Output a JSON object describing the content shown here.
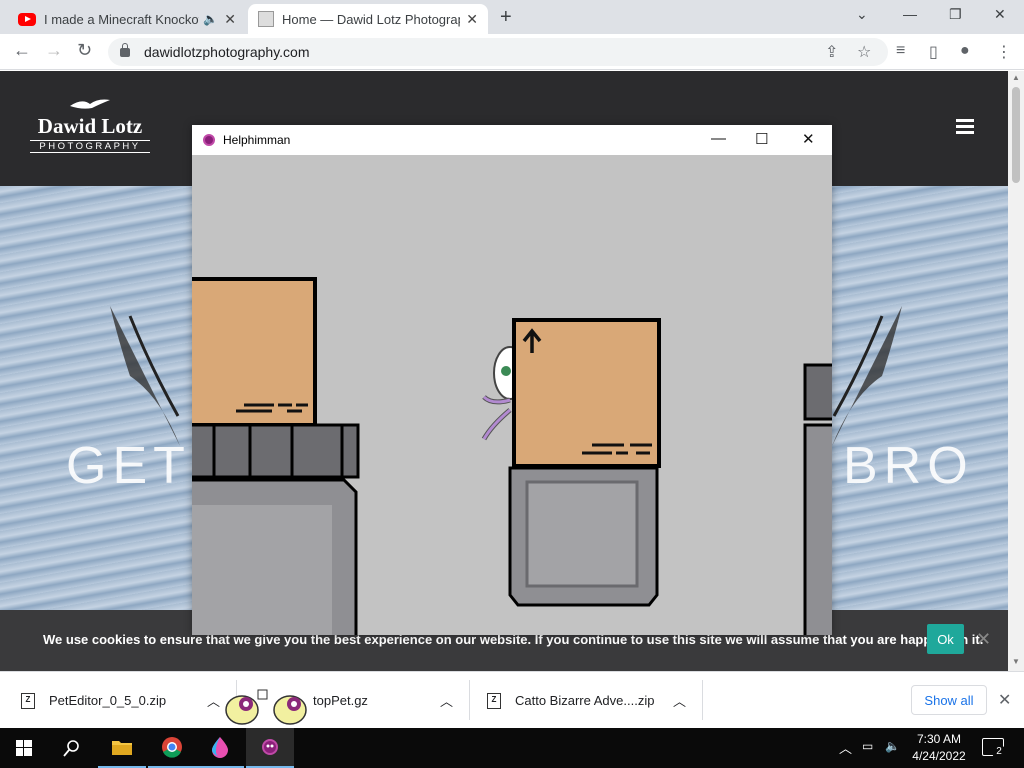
{
  "browser": {
    "tabs": [
      {
        "title": "I made a Minecraft Knockoff",
        "icon": "youtube-icon",
        "active": false
      },
      {
        "title": "Home — Dawid Lotz Photograp",
        "icon": "site-favicon",
        "active": true
      }
    ],
    "url": "dawidlotzphotography.com"
  },
  "site": {
    "logo_name": "Dawid Lotz",
    "logo_sub": "PHOTOGRAPHY",
    "hero_left": "GET",
    "hero_right": "BRO",
    "cookie_message": "We use cookies to ensure that we give you the best experience on our website. If you continue to use this site we will assume that you are happy with it.",
    "cookie_ok": "Ok"
  },
  "game_window": {
    "title": "Helphimman",
    "minimize": "—",
    "maximize": "☐",
    "close": "✕",
    "colors": {
      "background": "#c3c3c3",
      "crate": "#d9a877",
      "stone": "#8f8f93",
      "block": "#6c6c70"
    }
  },
  "downloads": {
    "items": [
      {
        "name": "PetEditor_0_5_0.zip"
      },
      {
        "name": "topPet.gz"
      },
      {
        "name": "Catto Bizarre Adve....zip"
      }
    ],
    "show_all": "Show all"
  },
  "taskbar": {
    "time": "7:30 AM",
    "date": "4/24/2022",
    "notifications": "2"
  }
}
